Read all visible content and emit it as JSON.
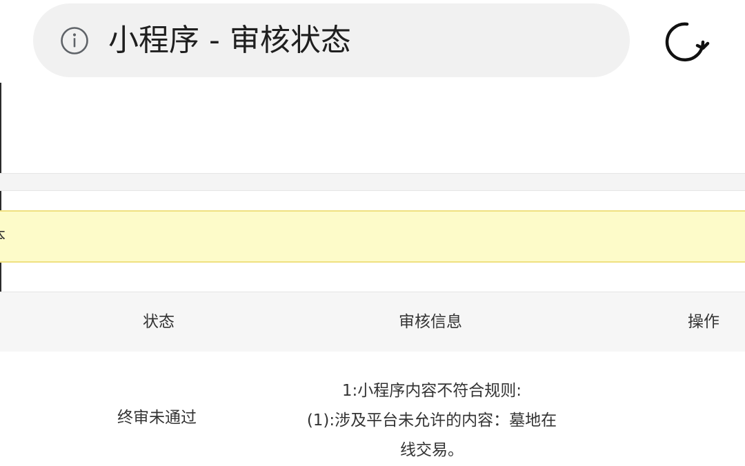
{
  "top_bar": {
    "title": "小程序 - 审核状态",
    "info_icon": "info-circle-icon",
    "reload_icon": "reload-icon"
  },
  "notice": {
    "text": "本"
  },
  "table": {
    "columns": [
      "状态",
      "审核信息",
      "操作"
    ],
    "rows": [
      {
        "status": "终审未通过",
        "review_info": [
          "1:小程序内容不符合规则:",
          "(1):涉及平台未允许的内容：墓地在",
          "线交易。"
        ],
        "action": ""
      }
    ]
  },
  "colors": {
    "notice_background": "#fdfbc9",
    "notice_border": "#efe07f",
    "pill_background": "#f1f1f1"
  }
}
